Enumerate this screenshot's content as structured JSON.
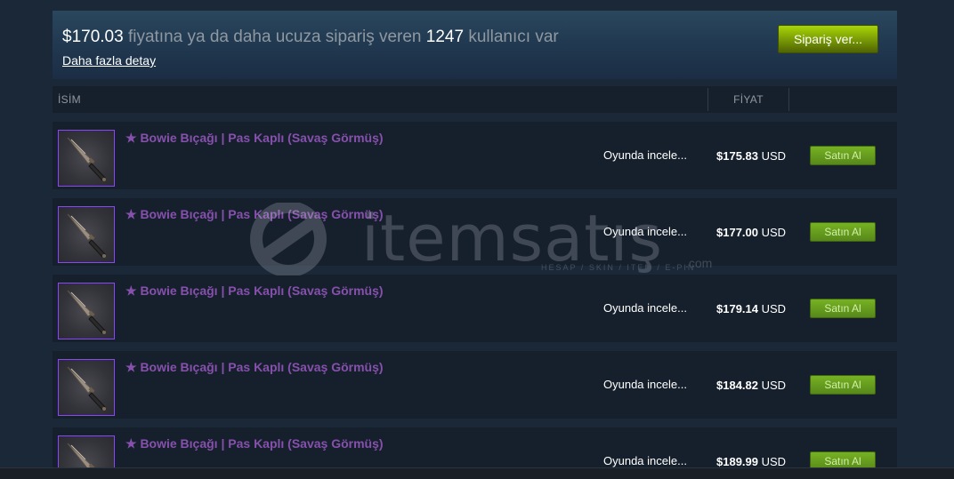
{
  "order_panel": {
    "price": "$170.03",
    "text_middle": " fiyatına ya da daha ucuza sipariş veren ",
    "count": "1247",
    "text_end": " kullanıcı var",
    "more_details": "Daha fazla detay",
    "order_button": "Sipariş ver..."
  },
  "table_header": {
    "name": "İSİM",
    "price": "FİYAT"
  },
  "listings": [
    {
      "name": "★ Bowie Bıçağı | Pas Kaplı (Savaş Görmüş)",
      "inspect": "Oyunda incele...",
      "price": "$175.83",
      "currency": "USD",
      "buy": "Satın Al"
    },
    {
      "name": "★ Bowie Bıçağı | Pas Kaplı (Savaş Görmüş)",
      "inspect": "Oyunda incele...",
      "price": "$177.00",
      "currency": "USD",
      "buy": "Satın Al"
    },
    {
      "name": "★ Bowie Bıçağı | Pas Kaplı (Savaş Görmüş)",
      "inspect": "Oyunda incele...",
      "price": "$179.14",
      "currency": "USD",
      "buy": "Satın Al"
    },
    {
      "name": "★ Bowie Bıçağı | Pas Kaplı (Savaş Görmüş)",
      "inspect": "Oyunda incele...",
      "price": "$184.82",
      "currency": "USD",
      "buy": "Satın Al"
    },
    {
      "name": "★ Bowie Bıçağı | Pas Kaplı (Savaş Görmüş)",
      "inspect": "Oyunda incele...",
      "price": "$189.99",
      "currency": "USD",
      "buy": "Satın Al"
    }
  ],
  "watermark": {
    "brand": "itemsatış",
    "tagline": "HESAP / SKIN / ITEM / E-PIN",
    "suffix": ".com"
  },
  "colors": {
    "background": "#1b2838",
    "rarity_covert_name": "#8650ac",
    "buy_button": "#75b022",
    "order_button": "#a4d007"
  },
  "icons": {
    "item_image": "bowie-knife-icon",
    "watermark_logo": "itemsatis-logo-icon"
  }
}
